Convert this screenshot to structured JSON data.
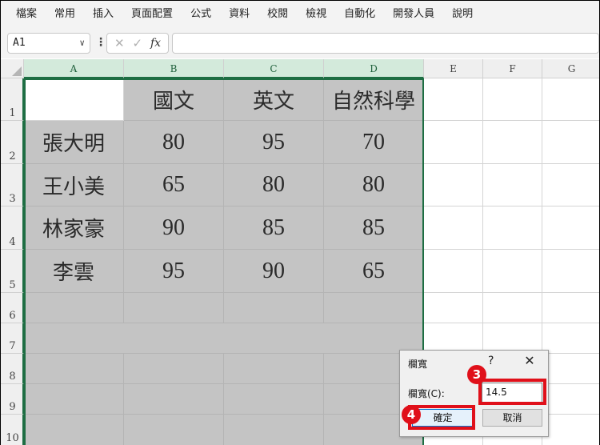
{
  "menu": [
    "檔案",
    "常用",
    "插入",
    "頁面配置",
    "公式",
    "資料",
    "校閱",
    "檢視",
    "自動化",
    "開發人員",
    "說明"
  ],
  "formula_bar": {
    "name_box": "A1",
    "formula_value": ""
  },
  "sheet": {
    "columns": [
      "A",
      "B",
      "C",
      "D",
      "E",
      "F",
      "G"
    ],
    "rows": [
      "1",
      "2",
      "3",
      "4",
      "5",
      "6",
      "7",
      "8",
      "9",
      "10"
    ],
    "header_row": [
      "",
      "國文",
      "英文",
      "自然科學"
    ],
    "data_rows": [
      [
        "張大明",
        "80",
        "95",
        "70"
      ],
      [
        "王小美",
        "65",
        "80",
        "80"
      ],
      [
        "林家豪",
        "90",
        "85",
        "85"
      ],
      [
        "李雲",
        "95",
        "90",
        "65"
      ]
    ]
  },
  "dialog": {
    "title": "欄寬",
    "help": "?",
    "label": "欄寬(C):",
    "value": "14.5",
    "ok": "確定",
    "cancel": "取消"
  },
  "annotations": {
    "badge_input": "3",
    "badge_ok": "4"
  },
  "colors": {
    "selection": "#1e6e43",
    "shade": "#c4c4c4",
    "annotation": "#e0101a"
  }
}
